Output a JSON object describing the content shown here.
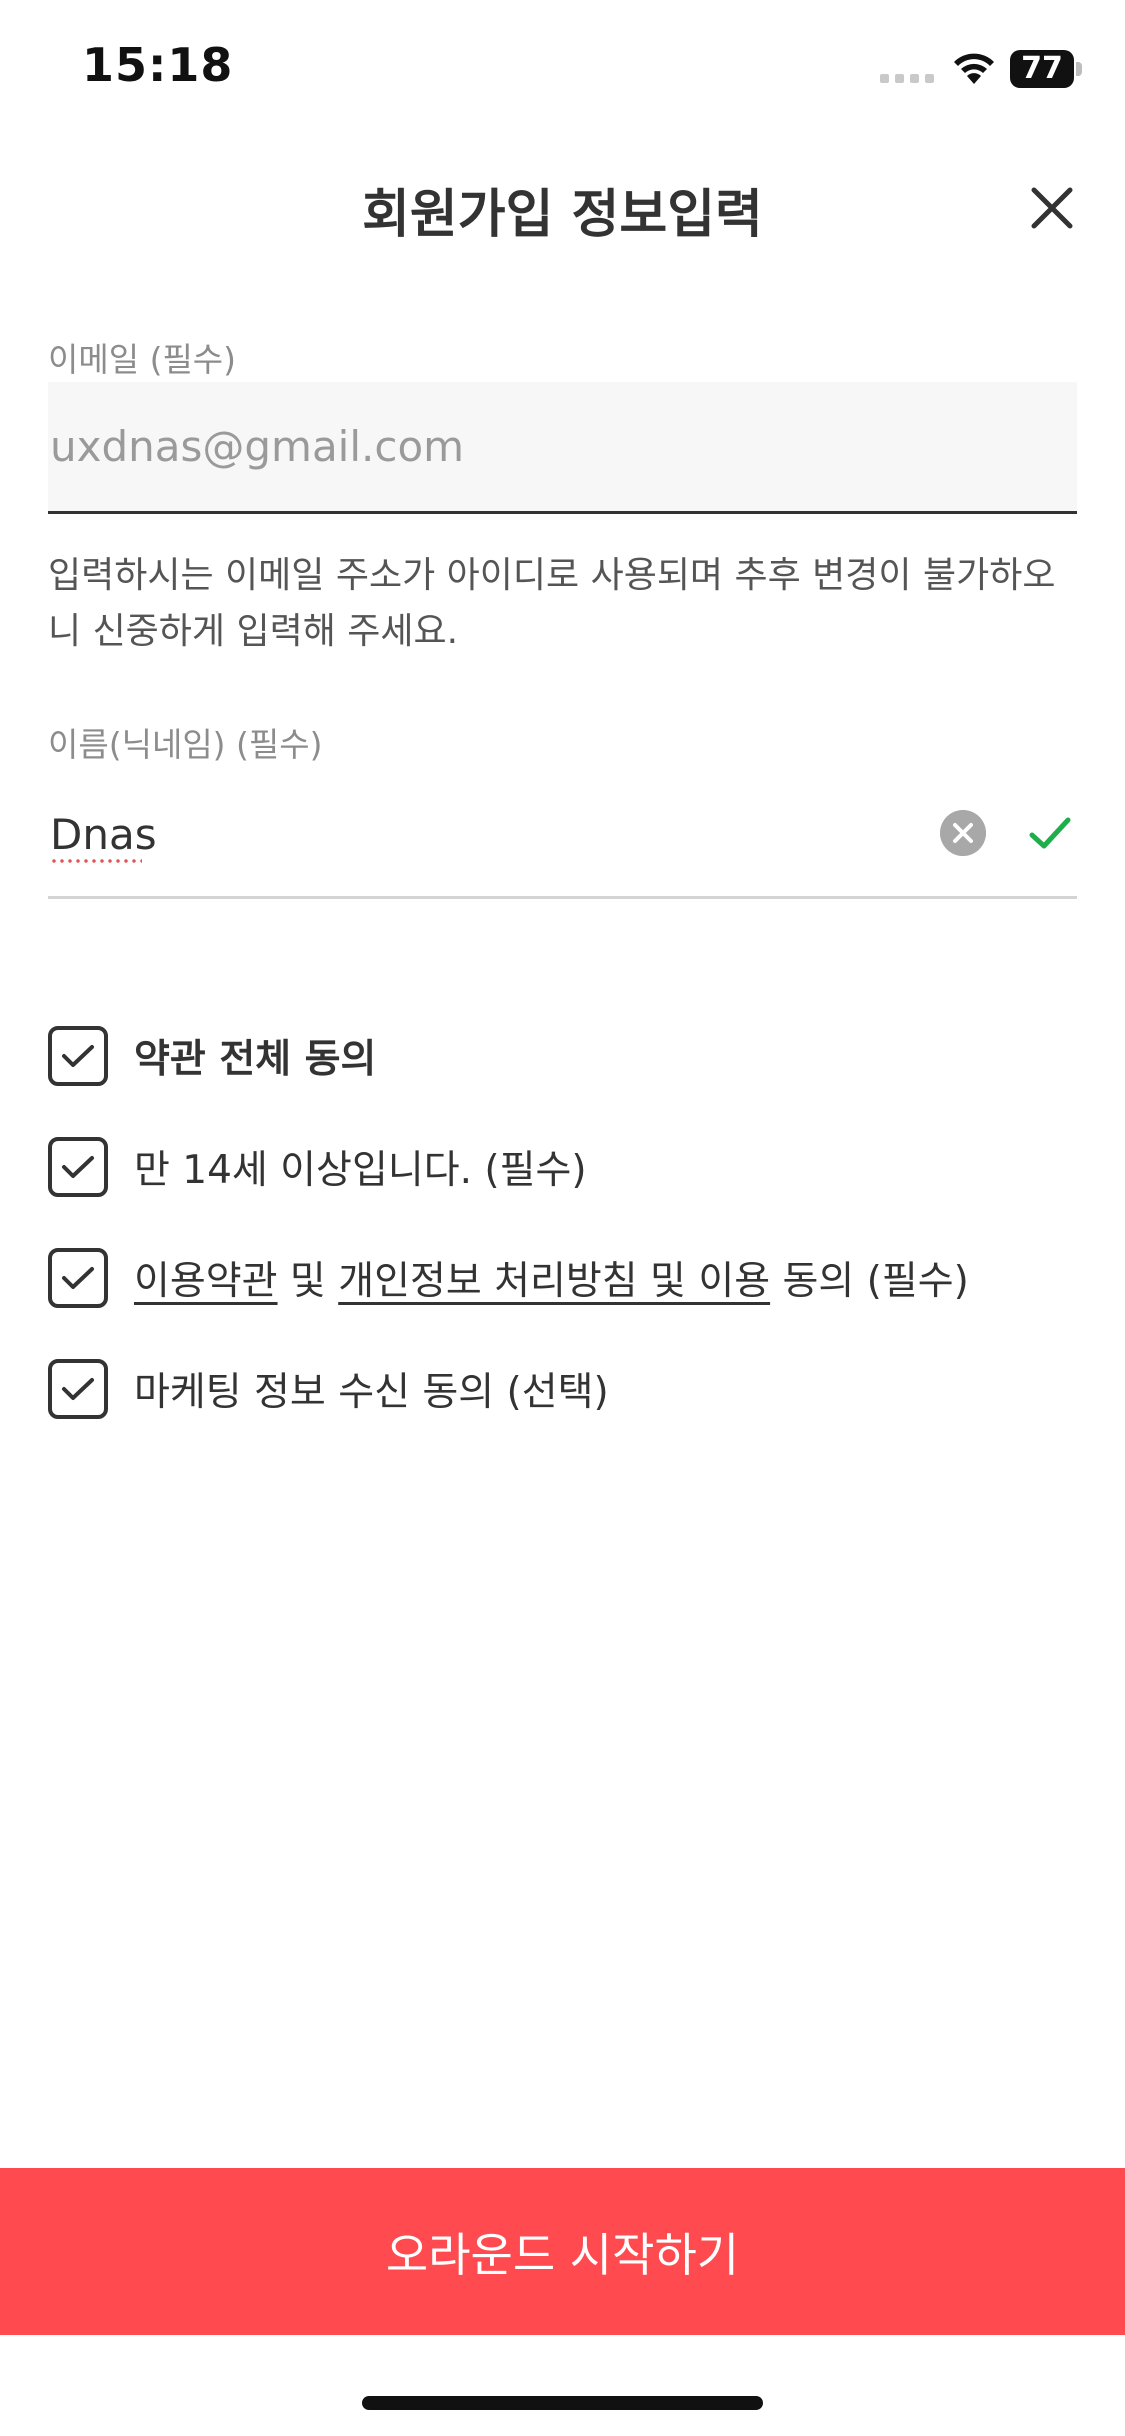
{
  "status_bar": {
    "time": "15:18",
    "battery_level": "77",
    "icons": [
      "signal-icon",
      "wifi-icon",
      "battery-icon"
    ]
  },
  "header": {
    "title": "회원가입 정보입력",
    "close_icon": "close-icon"
  },
  "form": {
    "email": {
      "label": "이메일 (필수)",
      "value": "uxdnas@gmail.com",
      "help": "입력하시는 이메일 주소가 아이디로 사용되며 추후 변경이 불가하오니 신중하게 입력해 주세요."
    },
    "name": {
      "label": "이름(닉네임) (필수)",
      "value": "Dnas",
      "clear_icon": "clear-icon",
      "valid_icon": "checkmark-icon"
    }
  },
  "agreements": {
    "all": {
      "label": "약관 전체 동의",
      "checked": true
    },
    "age": {
      "label": "만 14세 이상입니다. (필수)",
      "checked": true
    },
    "terms": {
      "link1": "이용약관",
      "and1": " 및 ",
      "link2": "개인정보 처리방침 및 이용",
      "suffix": " 동의 (필수)",
      "checked": true
    },
    "marketing": {
      "label": "마케팅 정보 수신 동의 (선택)",
      "checked": true
    }
  },
  "start_button": {
    "label": "오라운드 시작하기"
  },
  "colors": {
    "accent": "#ff4b4f",
    "valid": "#1fae4b",
    "text": "#333333",
    "muted": "#8c8c8c"
  }
}
